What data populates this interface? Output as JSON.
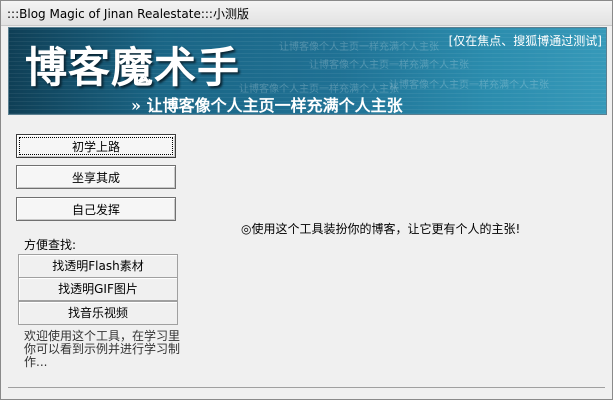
{
  "window": {
    "title": ":::Blog Magic of Jinan Realestate:::小测版"
  },
  "banner": {
    "title": "博客魔术手",
    "slogan": "» 让博客像个人主页一样充满个人主张",
    "tag": "[仅在焦点、搜狐博通过测试]",
    "ghost_text": "让博客像个人主页一样充满个人主张"
  },
  "left_panel": {
    "buttons": [
      {
        "label": "初学上路"
      },
      {
        "label": "坐享其成"
      },
      {
        "label": "自己发挥"
      }
    ],
    "finder_label": "方便查找:",
    "finder_buttons": [
      {
        "label": "找透明Flash素材"
      },
      {
        "label": "找透明GIF图片"
      },
      {
        "label": "找音乐视频"
      }
    ],
    "welcome_text": "欢迎使用这个工具，在学习里你可以看到示例并进行学习制作..."
  },
  "main": {
    "message": "◎使用这个工具装扮你的博客，让它更有个人的主张!"
  }
}
